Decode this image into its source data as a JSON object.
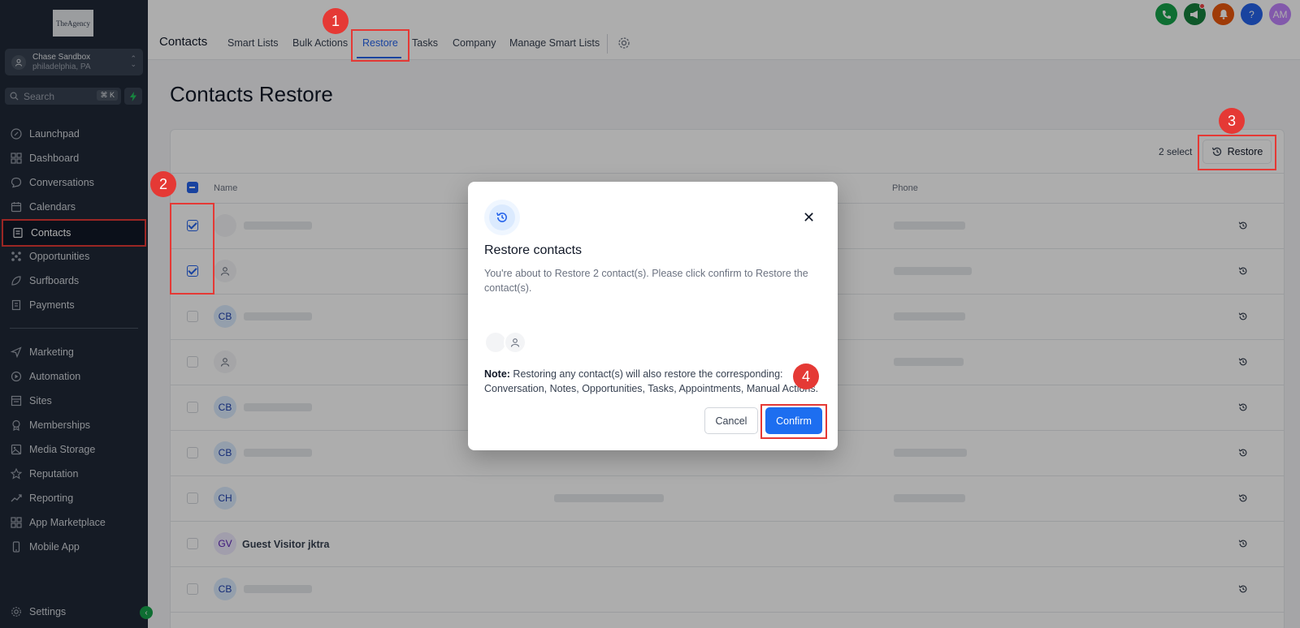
{
  "sidebar": {
    "logo_text": "TheAgency",
    "account": {
      "name": "Chase Sandbox",
      "location": "philadelphia, PA"
    },
    "search": {
      "placeholder": "Search",
      "shortcut": "⌘ K"
    },
    "items": [
      {
        "label": "Launchpad",
        "icon": "rocket-icon"
      },
      {
        "label": "Dashboard",
        "icon": "grid-icon"
      },
      {
        "label": "Conversations",
        "icon": "chat-icon"
      },
      {
        "label": "Calendars",
        "icon": "calendar-icon"
      },
      {
        "label": "Contacts",
        "icon": "contacts-icon",
        "active": true
      },
      {
        "label": "Opportunities",
        "icon": "network-icon"
      },
      {
        "label": "Surfboards",
        "icon": "surfboard-icon"
      },
      {
        "label": "Payments",
        "icon": "receipt-icon"
      },
      {
        "label": "Marketing",
        "icon": "send-icon"
      },
      {
        "label": "Automation",
        "icon": "automation-icon"
      },
      {
        "label": "Sites",
        "icon": "sites-icon"
      },
      {
        "label": "Memberships",
        "icon": "badge-icon"
      },
      {
        "label": "Media Storage",
        "icon": "image-icon"
      },
      {
        "label": "Reputation",
        "icon": "star-icon"
      },
      {
        "label": "Reporting",
        "icon": "trend-icon"
      },
      {
        "label": "App Marketplace",
        "icon": "apps-icon"
      },
      {
        "label": "Mobile App",
        "icon": "phone-icon"
      }
    ],
    "settings_label": "Settings"
  },
  "header": {
    "title": "Contacts",
    "tabs": [
      "Smart Lists",
      "Bulk Actions",
      "Restore",
      "Tasks",
      "Company",
      "Manage Smart Lists"
    ],
    "active_tab": "Restore",
    "avatar_initials": "AM",
    "help_label": "?"
  },
  "main": {
    "page_title": "Contacts Restore",
    "select_count": "2 select",
    "restore_label": "Restore",
    "columns": {
      "name": "Name",
      "phone": "Phone"
    },
    "rows": [
      {
        "initials": "",
        "name": "",
        "checked": true
      },
      {
        "initials": "",
        "name": "",
        "checked": true
      },
      {
        "initials": "CB",
        "name": "",
        "checked": false
      },
      {
        "initials": "",
        "name": "",
        "checked": false
      },
      {
        "initials": "CB",
        "name": "",
        "checked": false
      },
      {
        "initials": "CB",
        "name": "",
        "checked": false
      },
      {
        "initials": "CH",
        "name": "",
        "checked": false
      },
      {
        "initials": "GV",
        "name": "Guest Visitor jktra",
        "checked": false
      },
      {
        "initials": "CB",
        "name": "",
        "checked": false
      }
    ]
  },
  "modal": {
    "title": "Restore contacts",
    "description": "You're about to Restore 2 contact(s). Please click confirm to Restore the contact(s).",
    "note_label": "Note:",
    "note_text": " Restoring any contact(s) will also restore the corresponding: Conversation, Notes, Opportunities, Tasks, Appointments, Manual Actions.",
    "cancel_label": "Cancel",
    "confirm_label": "Confirm",
    "close_label": "✕"
  },
  "annotations": [
    "1",
    "2",
    "3",
    "4"
  ],
  "colors": {
    "accent": "#2563eb",
    "annotation": "#e53935",
    "sidebar_bg": "#1f2937"
  }
}
